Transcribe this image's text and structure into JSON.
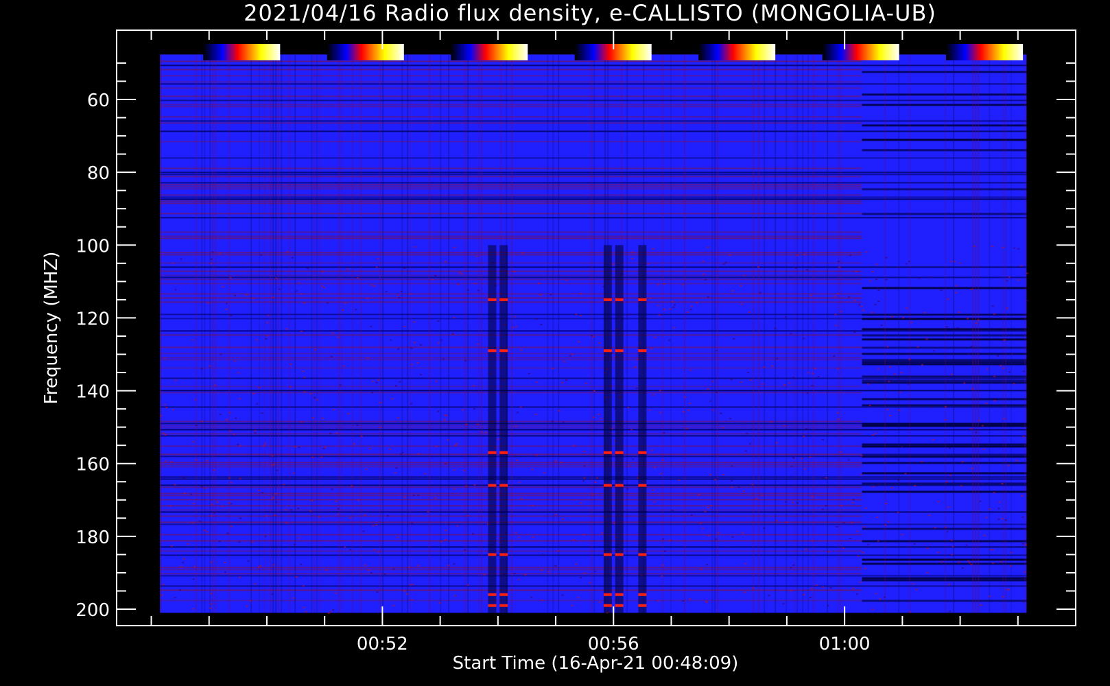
{
  "chart_data": {
    "type": "heatmap",
    "title": "2021/04/16  Radio flux density, e-CALLISTO (MONGOLIA-UB)",
    "xlabel": "Start Time (16-Apr-21 00:48:09)",
    "ylabel": "Frequency (MHZ)",
    "x_ticks": [
      "00:52",
      "00:56",
      "01:00"
    ],
    "y_ticks": [
      60,
      80,
      100,
      120,
      140,
      160,
      180,
      200
    ],
    "ylim": [
      45,
      201
    ],
    "x_range_minutes": [
      48.15,
      63.15
    ],
    "x_axis_minutes": [
      47.4,
      64.0
    ],
    "colormap": [
      "#000000",
      "#0000ff",
      "#ff0000",
      "#ffff00",
      "#ffffff"
    ],
    "colorbar_count": 7,
    "grid": false,
    "background_color": "#2020ff",
    "features": {
      "bright_bursts_minutes": [
        53.9,
        54.1,
        55.9,
        56.1,
        56.5
      ],
      "burst_red_bands_mhz": [
        115,
        129,
        157,
        166,
        185,
        196,
        199
      ],
      "quiet_region_start_minute": 60.3
    }
  }
}
